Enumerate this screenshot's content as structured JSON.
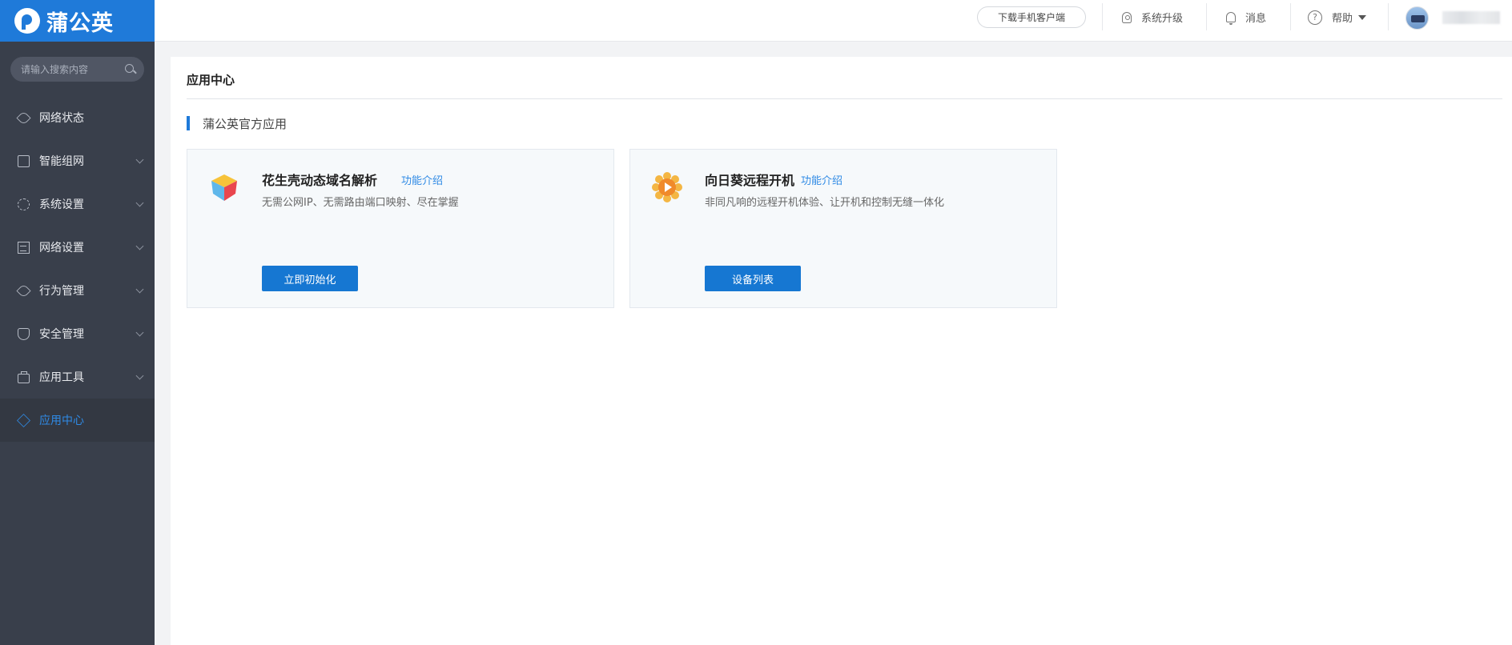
{
  "brand": {
    "name": "蒲公英"
  },
  "sidebar": {
    "search_placeholder": "请输入搜索内容",
    "items": [
      {
        "label": "网络状态",
        "icon": "eye-icon",
        "expandable": false,
        "active": false
      },
      {
        "label": "智能组网",
        "icon": "network-icon",
        "expandable": true,
        "active": false
      },
      {
        "label": "系统设置",
        "icon": "gear-icon",
        "expandable": true,
        "active": false
      },
      {
        "label": "网络设置",
        "icon": "document-icon",
        "expandable": true,
        "active": false
      },
      {
        "label": "行为管理",
        "icon": "eye-icon",
        "expandable": true,
        "active": false
      },
      {
        "label": "安全管理",
        "icon": "shield-icon",
        "expandable": true,
        "active": false
      },
      {
        "label": "应用工具",
        "icon": "briefcase-icon",
        "expandable": true,
        "active": false
      },
      {
        "label": "应用中心",
        "icon": "cube-icon",
        "expandable": false,
        "active": true
      }
    ]
  },
  "header": {
    "download_label": "下载手机客户端",
    "upgrade_label": "系统升级",
    "messages_label": "消息",
    "help_label": "帮助"
  },
  "main": {
    "page_title": "应用中心",
    "section_title": "蒲公英官方应用",
    "cards": [
      {
        "title": "花生壳动态域名解析",
        "link": "功能介绍",
        "description": "无需公网IP、无需路由端口映射、尽在掌握",
        "button": "立即初始化",
        "icon": "peanut-shell-cube-icon"
      },
      {
        "title": "向日葵远程开机",
        "link": "功能介绍",
        "description": "非同凡响的远程开机体验、让开机和控制无缝一体化",
        "button": "设备列表",
        "icon": "sunflower-icon"
      }
    ]
  },
  "colors": {
    "brand_blue": "#1f7ad9",
    "sidebar_bg": "#393f4b",
    "active_text": "#2f8ae5",
    "button_blue": "#1677d2"
  }
}
